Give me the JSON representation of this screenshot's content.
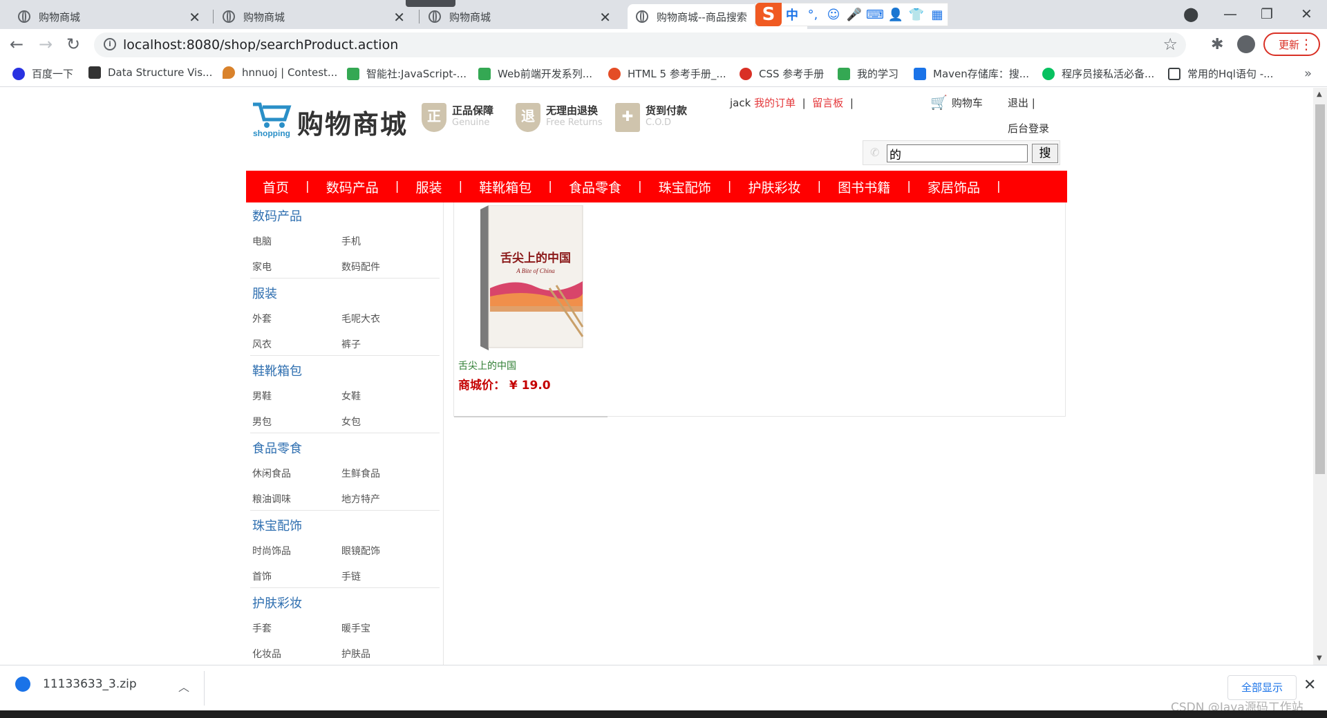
{
  "browser": {
    "tabs": [
      {
        "title": "购物商城",
        "active": false
      },
      {
        "title": "购物商城",
        "active": false
      },
      {
        "title": "购物商城",
        "active": false
      },
      {
        "title": "购物商城--商品搜索",
        "active": true
      }
    ],
    "ime": {
      "logo": "S",
      "mode": "中",
      "punct": "°,"
    },
    "url": "localhost:8080/shop/searchProduct.action",
    "update_label": "更新",
    "bookmarks": [
      {
        "label": "百度一下",
        "icon": "paw-icon",
        "color": "#2932e1"
      },
      {
        "label": "Data Structure Vis...",
        "icon": "dsv-icon",
        "color": "#333333"
      },
      {
        "label": "hnnuoj | Contest...",
        "icon": "pin-icon",
        "color": "#d9822b"
      },
      {
        "label": "智能社:JavaScript-...",
        "icon": "folder-icon",
        "color": "#34a853"
      },
      {
        "label": "Web前端开发系列...",
        "icon": "folder-icon",
        "color": "#34a853"
      },
      {
        "label": "HTML 5 参考手册_...",
        "icon": "w3-icon",
        "color": "#e44d26"
      },
      {
        "label": "CSS 参考手册",
        "icon": "css-icon",
        "color": "#d93025"
      },
      {
        "label": "我的学习",
        "icon": "folder-icon",
        "color": "#34a853"
      },
      {
        "label": "Maven存储库：搜...",
        "icon": "mvn-icon",
        "color": "#1a73e8"
      },
      {
        "label": "程序员接私活必备...",
        "icon": "wechat-icon",
        "color": "#07c160"
      },
      {
        "label": "常用的Hql语句 -...",
        "icon": "feather-icon",
        "color": "#3c4043"
      }
    ]
  },
  "site": {
    "brand": "购物商城",
    "brand_sub": "shopping",
    "promises": [
      {
        "cn": "正品保障",
        "en": "Genuine",
        "glyph": "正"
      },
      {
        "cn": "无理由退换",
        "en": "Free Returns",
        "glyph": "退"
      },
      {
        "cn": "货到付款",
        "en": "C.O.D",
        "glyph": "✚"
      }
    ],
    "user": {
      "name": "jack",
      "orders": "我的订单",
      "sep1": "|",
      "board": "留言板",
      "sep2": "|"
    },
    "cart_label": "购物车",
    "logout": "退出",
    "logout_sep": "|",
    "admin_login": "后台登录",
    "search": {
      "value": "的",
      "button": "搜"
    },
    "nav": [
      "首页",
      "数码产品",
      "服装",
      "鞋靴箱包",
      "食品零食",
      "珠宝配饰",
      "护肤彩妆",
      "图书书籍",
      "家居饰品"
    ],
    "nav_sep": "|",
    "categories": [
      {
        "title": "数码产品",
        "subs": [
          "电脑",
          "手机",
          "家电",
          "数码配件"
        ]
      },
      {
        "title": "服装",
        "subs": [
          "外套",
          "毛呢大衣",
          "风衣",
          "裤子"
        ]
      },
      {
        "title": "鞋靴箱包",
        "subs": [
          "男鞋",
          "女鞋",
          "男包",
          "女包"
        ]
      },
      {
        "title": "食品零食",
        "subs": [
          "休闲食品",
          "生鲜食品",
          "粮油调味",
          "地方特产"
        ]
      },
      {
        "title": "珠宝配饰",
        "subs": [
          "时尚饰品",
          "眼镜配饰",
          "首饰",
          "手链"
        ]
      },
      {
        "title": "护肤彩妆",
        "subs": [
          "手套",
          "暖手宝",
          "化妆品",
          "护肤品"
        ]
      }
    ],
    "product": {
      "name": "舌尖上的中国",
      "price_label": "商城价：",
      "price": "¥ 19.0",
      "cover_title": "舌尖上的中国",
      "cover_subtitle": "A Bite of China"
    }
  },
  "downloads": {
    "file": "11133633_3.zip",
    "show_all": "全部显示"
  },
  "watermark": "CSDN @Java源码工作站"
}
